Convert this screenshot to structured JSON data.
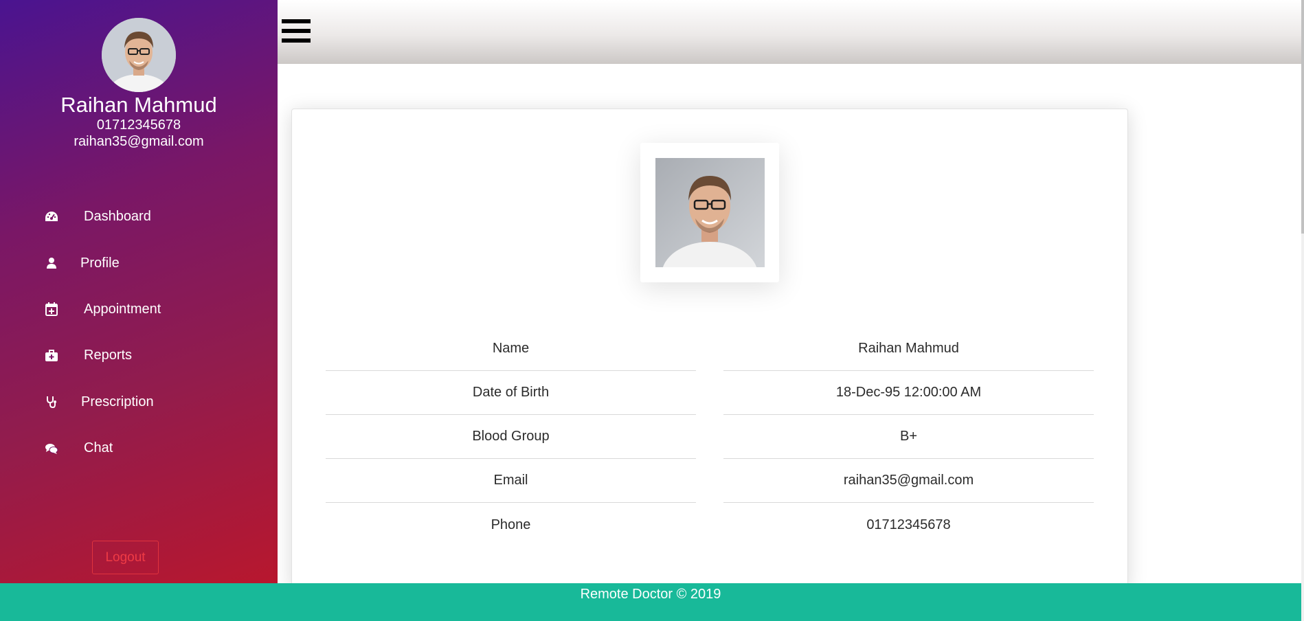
{
  "sidebar": {
    "user": {
      "name": "Raihan Mahmud",
      "phone": "01712345678",
      "email": "raihan35@gmail.com"
    },
    "nav": [
      {
        "label": "Dashboard",
        "icon": "dashboard-icon"
      },
      {
        "label": "Profile",
        "icon": "user-icon"
      },
      {
        "label": "Appointment",
        "icon": "calendar-plus-icon"
      },
      {
        "label": "Reports",
        "icon": "medkit-icon"
      },
      {
        "label": "Prescription",
        "icon": "stethoscope-icon"
      },
      {
        "label": "Chat",
        "icon": "chat-icon"
      }
    ],
    "logout_label": "Logout"
  },
  "profile": {
    "labels": [
      "Name",
      "Date of Birth",
      "Blood Group",
      "Email",
      "Phone"
    ],
    "values": [
      "Raihan Mahmud",
      "18-Dec-95 12:00:00 AM",
      "B+",
      "raihan35@gmail.com",
      "01712345678"
    ]
  },
  "footer": {
    "text": "Remote Doctor © 2019"
  },
  "colors": {
    "footer": "#18b999",
    "logout": "#ef3b45",
    "sidebar_top": "#4a1490",
    "sidebar_bottom": "#b8172e"
  }
}
